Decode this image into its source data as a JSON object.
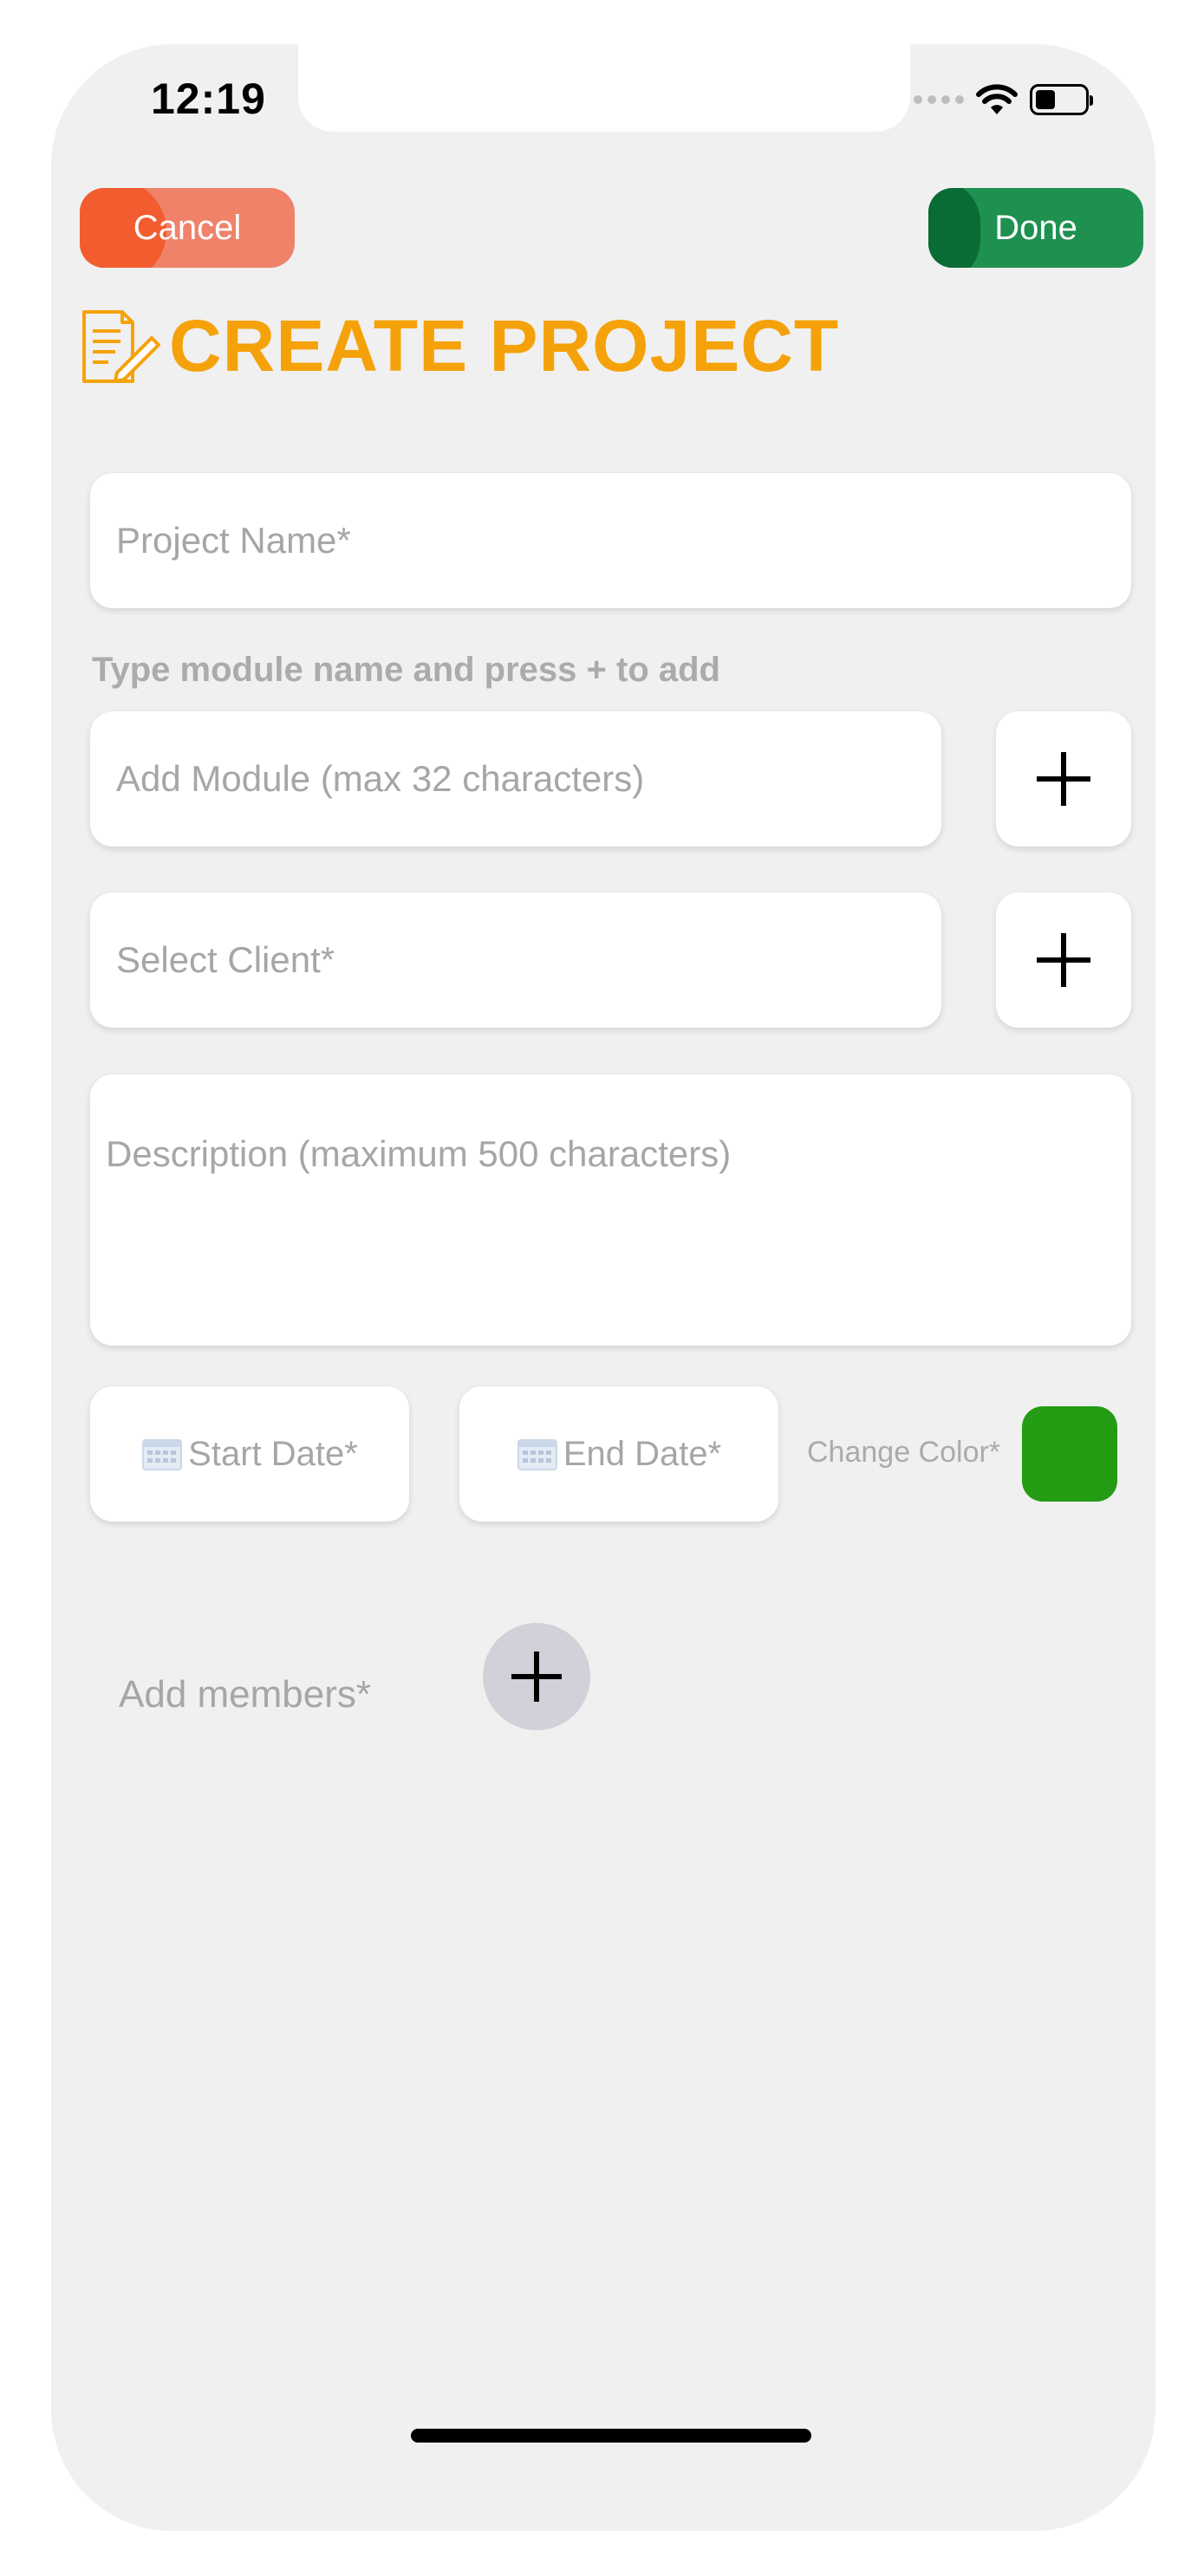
{
  "status_bar": {
    "time": "12:19",
    "icons": [
      "cellular-signal-icon",
      "wifi-icon",
      "battery-icon"
    ],
    "battery_level": 0.4
  },
  "header": {
    "cancel_label": "Cancel",
    "done_label": "Done",
    "title": "CREATE PROJECT",
    "title_icon": "document-edit-icon"
  },
  "form": {
    "project_name_placeholder": "Project Name*",
    "module_hint": "Type module name and press + to add",
    "module_placeholder": "Add Module (max 32 characters)",
    "client_placeholder": "Select Client*",
    "description_placeholder": "Description (maximum 500 characters)",
    "start_date_label": "Start Date*",
    "end_date_label": "End Date*",
    "change_color_label": "Change Color*",
    "selected_color": "#249c14",
    "add_members_label": "Add members*"
  },
  "colors": {
    "accent_title": "#f5a20a",
    "cancel": "#f25c2e",
    "done": "#1e9150",
    "background": "#f0f0f0"
  }
}
